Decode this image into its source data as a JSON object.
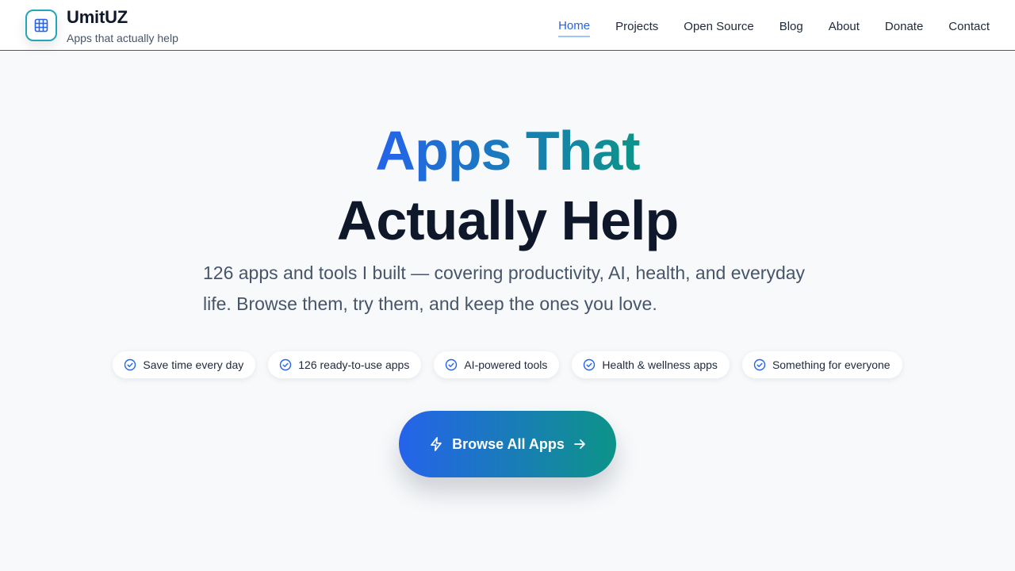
{
  "brand": {
    "name": "UmitUZ",
    "tagline": "Apps that actually help",
    "logo_icon": "grid-icon"
  },
  "nav": {
    "items": [
      {
        "label": "Home",
        "active": true
      },
      {
        "label": "Projects"
      },
      {
        "label": "Open Source"
      },
      {
        "label": "Blog"
      },
      {
        "label": "About"
      },
      {
        "label": "Donate"
      },
      {
        "label": "Contact"
      }
    ]
  },
  "hero": {
    "title_line1": "Apps That",
    "title_line2": "Actually Help",
    "subtitle": "126 apps and tools I built — covering productivity, AI, health, and everyday life. Browse them, try them, and keep the ones you love."
  },
  "features": [
    {
      "label": "Save time every day",
      "icon": "check-circle-icon"
    },
    {
      "label": "126 ready-to-use apps",
      "icon": "check-circle-icon"
    },
    {
      "label": "AI-powered tools",
      "icon": "check-circle-icon"
    },
    {
      "label": "Health & wellness apps",
      "icon": "check-circle-icon"
    },
    {
      "label": "Something for everyone",
      "icon": "check-circle-icon"
    }
  ],
  "cta": {
    "label": "Browse All Apps",
    "leading_icon": "lightning-icon",
    "trailing_icon": "arrow-right-icon"
  },
  "colors": {
    "accent_start": "#2563eb",
    "accent_end": "#0d9488",
    "text_dark": "#0f172a",
    "text_muted": "#475569"
  }
}
